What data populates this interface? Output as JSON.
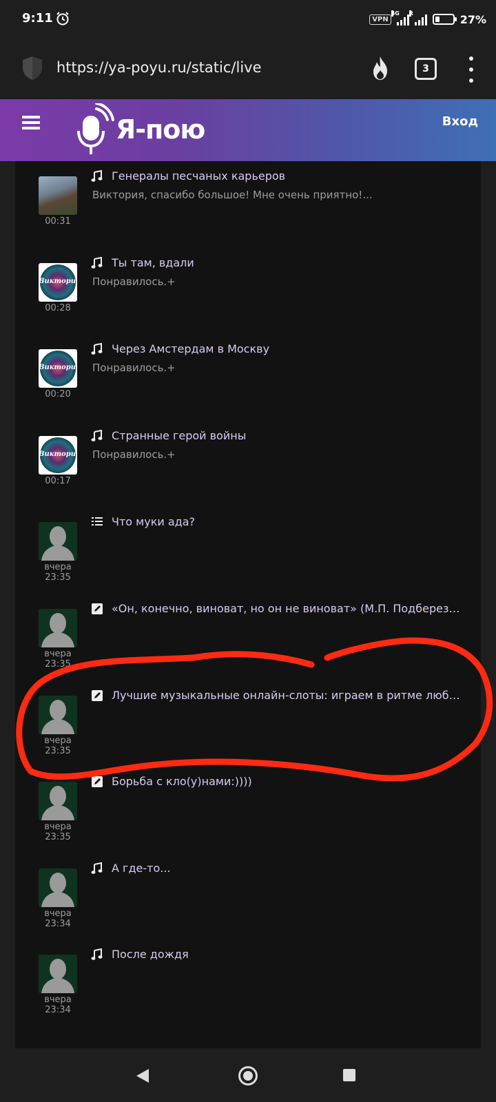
{
  "status_bar": {
    "time": "9:11",
    "vpn": "VPN",
    "net1": "4G",
    "net2": "R",
    "battery_percent": 27,
    "battery_text": "27%"
  },
  "browser": {
    "url": "https://ya-poyu.ru/static/live",
    "tab_count": "3"
  },
  "site": {
    "logo_text": "Я-пою",
    "login_label": "Вход",
    "colors": {
      "header_start": "#7b3aa8",
      "header_end": "#3f6fb5",
      "title_text": "#d9ccf0",
      "annotation": "#ff2a12"
    }
  },
  "feed": [
    {
      "avatar": "photo",
      "icon": "music-note",
      "title": "Генералы песчаных карьеров",
      "subtitle": "Виктория, спасибо большое! Мне очень приятно!...",
      "time1": "00:31",
      "time2": ""
    },
    {
      "avatar": "victoria",
      "avatar_text": "Виктория",
      "icon": "music-note",
      "title": "Ты там, вдали",
      "subtitle": "Понравилось.+",
      "time1": "00:28",
      "time2": ""
    },
    {
      "avatar": "victoria",
      "avatar_text": "Виктория",
      "icon": "music-note",
      "title": "Через Амстердам в Москву",
      "subtitle": "Понравилось.+",
      "time1": "00:20",
      "time2": ""
    },
    {
      "avatar": "victoria",
      "avatar_text": "Виктория",
      "icon": "music-note",
      "title": "Странные герой войны",
      "subtitle": "Понравилось.+",
      "time1": "00:17",
      "time2": ""
    },
    {
      "avatar": "default",
      "icon": "list",
      "title": "Что муки ада?",
      "subtitle": "",
      "time1": "вчера",
      "time2": "23:35"
    },
    {
      "avatar": "default",
      "icon": "pencil",
      "title": "«Он, конечно, виноват, но он не виноват» (М.П. Подберез…",
      "subtitle": "",
      "time1": "вчера",
      "time2": "23:35"
    },
    {
      "avatar": "default",
      "icon": "pencil",
      "title": "Лучшие музыкальные онлайн-слоты: играем в ритме люб…",
      "subtitle": "",
      "time1": "вчера",
      "time2": "23:35"
    },
    {
      "avatar": "default",
      "icon": "pencil",
      "title": "Борьба с кло(у)нами:))))",
      "subtitle": "",
      "time1": "вчера",
      "time2": "23:35"
    },
    {
      "avatar": "default",
      "icon": "music-note",
      "title": "А где-то...",
      "subtitle": "",
      "time1": "вчера",
      "time2": "23:34"
    },
    {
      "avatar": "default",
      "icon": "music-note",
      "title": "После дождя",
      "subtitle": "",
      "time1": "вчера",
      "time2": "23:34"
    }
  ]
}
